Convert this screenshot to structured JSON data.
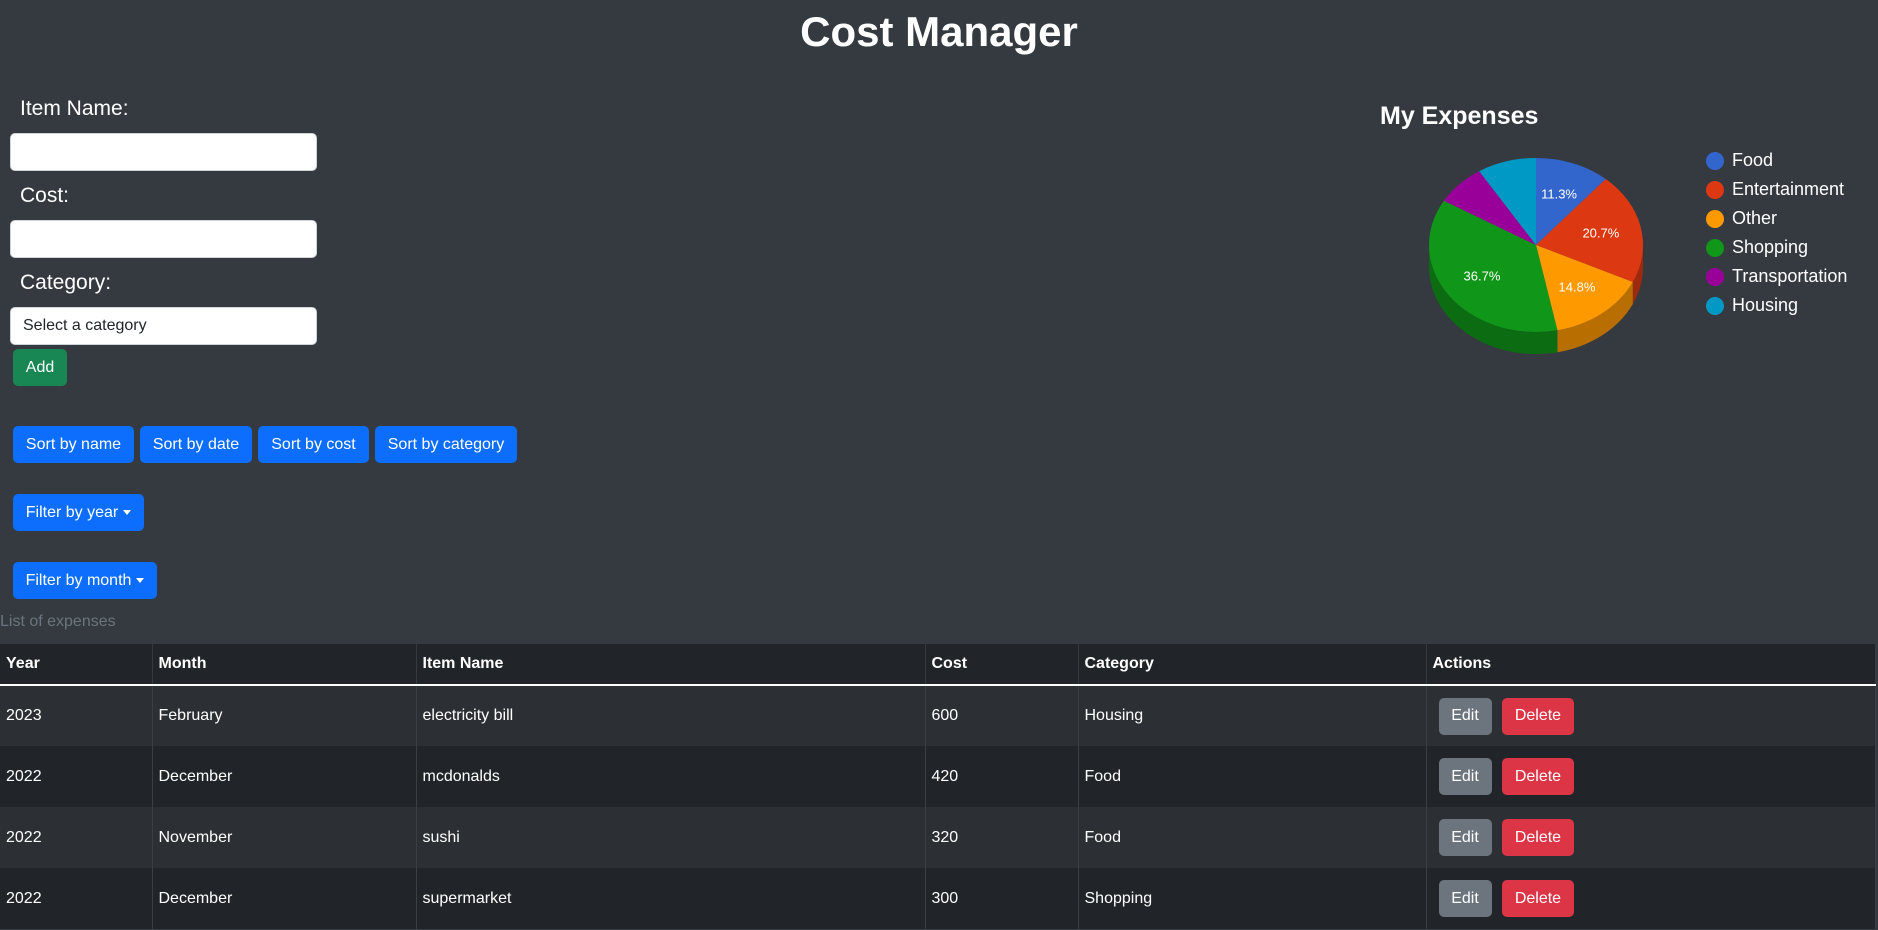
{
  "header": {
    "title": "Cost Manager"
  },
  "form": {
    "item_name_label": "Item Name:",
    "item_name_value": "",
    "cost_label": "Cost:",
    "cost_value": "",
    "category_label": "Category:",
    "category_selected": "Select a category",
    "add_label": "Add"
  },
  "sort": {
    "by_name": "Sort by name",
    "by_date": "Sort by date",
    "by_cost": "Sort by cost",
    "by_category": "Sort by category"
  },
  "filters": {
    "year_label": "Filter by year",
    "month_label": "Filter by month"
  },
  "table": {
    "caption": "List of expenses",
    "headers": [
      "Year",
      "Month",
      "Item Name",
      "Cost",
      "Category",
      "Actions"
    ],
    "edit_label": "Edit",
    "delete_label": "Delete",
    "rows": [
      [
        "2023",
        "February",
        "electricity bill",
        "600",
        "Housing"
      ],
      [
        "2022",
        "December",
        "mcdonalds",
        "420",
        "Food"
      ],
      [
        "2022",
        "November",
        "sushi",
        "320",
        "Food"
      ],
      [
        "2022",
        "December",
        "supermarket",
        "300",
        "Shopping"
      ]
    ]
  },
  "chart_data": {
    "type": "pie",
    "title": "My Expenses",
    "legend_position": "right",
    "categories": [
      "Food",
      "Entertainment",
      "Other",
      "Shopping",
      "Transportation",
      "Housing"
    ],
    "values": [
      11.3,
      20.7,
      14.8,
      36.7,
      7.6,
      8.9
    ],
    "labels": [
      "11.3%",
      "20.7%",
      "14.8%",
      "36.7%",
      "",
      ""
    ],
    "colors": [
      "#3366cc",
      "#dc3912",
      "#ff9900",
      "#109618",
      "#990099",
      "#0099c6"
    ]
  }
}
